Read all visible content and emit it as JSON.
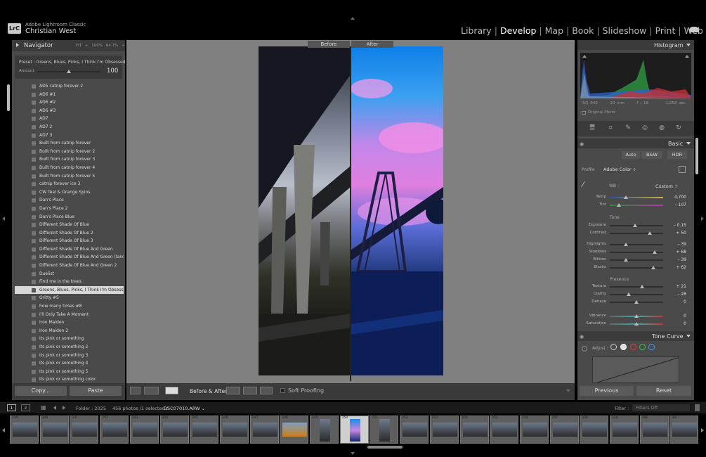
{
  "app": {
    "logo": "LrC",
    "name": "Adobe Lightroom Classic",
    "user": "Christian West"
  },
  "modules": [
    {
      "label": "Library",
      "active": false
    },
    {
      "label": "Develop",
      "active": true
    },
    {
      "label": "Map",
      "active": false
    },
    {
      "label": "Book",
      "active": false
    },
    {
      "label": "Slideshow",
      "active": false
    },
    {
      "label": "Print",
      "active": false
    },
    {
      "label": "Web",
      "active": false
    }
  ],
  "navigator": {
    "title": "Navigator",
    "zoom_levels": "FIT ÷  100%  64.7%  ÷"
  },
  "preset_panel": {
    "preset_label": "Preset : Greens, Blues, Pinks, I Think I'm Obsessed",
    "amount_label": "Amount",
    "amount_value": "100",
    "amount_fraction": 0.5
  },
  "presets": [
    "AD5 catnip forever 2",
    "AD6 #1",
    "AD6 #2",
    "AD6 #3",
    "AD7",
    "AD7 2",
    "AD7 3",
    "Built from catnip forever",
    "Built from catnip forever 2",
    "Built from catnip forever 3",
    "Built from catnip forever 4",
    "Built from catnip forever 5",
    "catnip forever ice 3",
    "CW Teal & Orange Spins",
    "Dan's Place",
    "Dan's Place 2",
    "Dan's Place Blue",
    "Different Shade Of Blue",
    "Different Shade Of Blue 2",
    "Different Shade Of Blue 3",
    "Different Shade Of Blue And Green",
    "Different Shade Of Blue And Green (land...",
    "Different Shade Of Blue And Green 2",
    "Duelist",
    "Find me in the trees",
    "Greens, Blues, Pinks, I Think I'm Obsessed",
    "Gritty #5",
    "how many times #8",
    "I'll Only Take A Moment",
    "Iron Maiden",
    "Iron Maiden 2",
    "Its pink or something",
    "Its pink or something 2",
    "Its pink or something 3",
    "Its pink or something 4",
    "Its pink or something 5",
    "Its pink or something color"
  ],
  "selected_preset": "Greens, Blues, Pinks, I Think I'm Obsessed",
  "left_buttons": {
    "copy": "Copy...",
    "paste": "Paste"
  },
  "view": {
    "before_label": "Before",
    "after_label": "After"
  },
  "toolbar": {
    "before_after_label": "Before & After :",
    "soft_proofing": "Soft Proofing"
  },
  "histogram": {
    "title": "Histogram",
    "iso": "ISO 640",
    "focal": "20 mm",
    "aperture": "f / 18",
    "shutter": "1/250 sec",
    "original_photo": "Original Photo"
  },
  "basic": {
    "title": "Basic",
    "treatment_auto": "Auto",
    "treatment_bw": "B&W",
    "treatment_hdr": "HDR",
    "profile_label": "Profile",
    "profile_value": "Adobe Color ÷",
    "wb_label": "WB :",
    "wb_value": "Custom ÷",
    "tone_label": "Tone",
    "presence_label": "Presence",
    "sliders": [
      {
        "label": "Temp",
        "value": "4,700",
        "pos": 0.3
      },
      {
        "label": "Tint",
        "value": "– 107",
        "pos": 0.17
      },
      {
        "label": "Exposure",
        "value": "– 0.15",
        "pos": 0.48
      },
      {
        "label": "Contrast",
        "value": "+ 50",
        "pos": 0.75
      },
      {
        "label": "Highlights",
        "value": "– 39",
        "pos": 0.3
      },
      {
        "label": "Shadows",
        "value": "+ 68",
        "pos": 0.84
      },
      {
        "label": "Whites",
        "value": "– 39",
        "pos": 0.3
      },
      {
        "label": "Blacks",
        "value": "+ 62",
        "pos": 0.81
      },
      {
        "label": "Texture",
        "value": "+ 21",
        "pos": 0.6
      },
      {
        "label": "Clarity",
        "value": "– 28",
        "pos": 0.36
      },
      {
        "label": "Dehaze",
        "value": "0",
        "pos": 0.5
      },
      {
        "label": "Vibrance",
        "value": "0",
        "pos": 0.5
      },
      {
        "label": "Saturation",
        "value": "0",
        "pos": 0.5
      }
    ]
  },
  "tone_curve": {
    "title": "Tone Curve",
    "adjust_label": "Adjust :"
  },
  "right_buttons": {
    "previous": "Previous",
    "reset": "Reset"
  },
  "filmstrip": {
    "page1": "1",
    "page2": "2",
    "folder_label": "Folder : 2025",
    "photo_count": "456 photos /1 selected /",
    "filename": "DSC07010.ARW ⌄",
    "filter_label": "Filter :",
    "filter_value": "Filters Off",
    "thumbs": [
      "239",
      "240",
      "241",
      "242",
      "243",
      "244",
      "245",
      "246",
      "247",
      "248",
      "249",
      "250",
      "251",
      "252",
      "253",
      "254",
      "255",
      "256",
      "257",
      "258",
      "259",
      "260",
      "261"
    ],
    "selected_thumb": "250"
  }
}
